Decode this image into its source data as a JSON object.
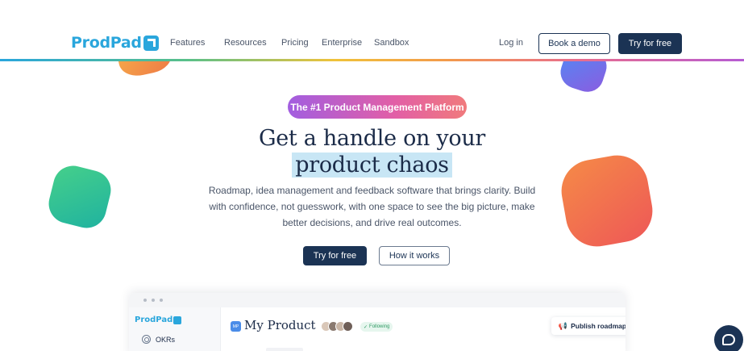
{
  "nav": {
    "logo_text": "ProdPad",
    "links": [
      "Features",
      "Resources",
      "Pricing",
      "Enterprise",
      "Sandbox"
    ],
    "login": "Log in",
    "demo": "Book a demo",
    "try": "Try for free"
  },
  "hero": {
    "pill": "The #1 Product Management Platform",
    "title_line1": "Get a handle on your",
    "title_line2": "product chaos",
    "subtitle": "Roadmap, idea management and feedback software that brings clarity. Build with confidence, not guesswork, with one space to see the big picture, make better decisions, and drive real outcomes.",
    "cta_primary": "Try for free",
    "cta_secondary": "How it works"
  },
  "preview": {
    "logo_text": "ProdPad",
    "sidebar_item": "OKRs",
    "product_badge": "MP",
    "product_title": "My Product",
    "following": "Following",
    "publish": "Publish roadmap"
  },
  "colors": {
    "navy": "#1b3354",
    "brand_blue": "#2aa6dc",
    "highlight": "#c8e6f5"
  },
  "icons": {
    "logo_mark": "prodpad-arrow-icon",
    "okr": "target-icon",
    "publish": "megaphone-icon",
    "chat": "chat-bubble-icon"
  }
}
